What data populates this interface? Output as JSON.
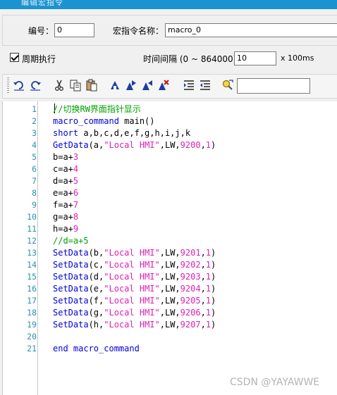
{
  "window": {
    "title": "编辑宏指令"
  },
  "header": {
    "id_label": "编号：",
    "id_value": "0",
    "name_label": "宏指令名称：",
    "name_value": "macro_0",
    "periodic_label": "周期执行",
    "periodic_checked": true,
    "interval_label": "时间间隔 (0 ~ 864000)：",
    "interval_value": "10",
    "interval_unit": "x 100ms"
  },
  "toolbar": {
    "buttons": [
      "undo-icon",
      "redo-icon",
      "cut-icon",
      "copy-icon",
      "paste-icon",
      "toggle-bookmark-icon",
      "next-bookmark-icon",
      "prev-bookmark-icon",
      "clear-bookmarks-icon",
      "indent-icon",
      "outdent-icon",
      "find-icon"
    ],
    "search_value": ""
  },
  "editor": {
    "lines": [
      {
        "n": "1",
        "t": [
          [
            "cmt",
            "//切换RW界面指针显示"
          ]
        ]
      },
      {
        "n": "2",
        "t": [
          [
            "kw",
            "macro_command"
          ],
          [
            "plain",
            " main()"
          ]
        ]
      },
      {
        "n": "3",
        "t": [
          [
            "kw",
            "short"
          ],
          [
            "plain",
            " a,b,c,d,e,f,g,h,i,j,k"
          ]
        ]
      },
      {
        "n": "4",
        "t": [
          [
            "fn",
            "GetData"
          ],
          [
            "plain",
            "(a,"
          ],
          [
            "str",
            "\"Local HMI\""
          ],
          [
            "plain",
            ",LW,"
          ],
          [
            "num",
            "9200"
          ],
          [
            "plain",
            ","
          ],
          [
            "num",
            "1"
          ],
          [
            "plain",
            ")"
          ]
        ]
      },
      {
        "n": "5",
        "t": [
          [
            "plain",
            "b=a+"
          ],
          [
            "num",
            "3"
          ]
        ]
      },
      {
        "n": "6",
        "t": [
          [
            "plain",
            "c=a+"
          ],
          [
            "num",
            "4"
          ]
        ]
      },
      {
        "n": "7",
        "t": [
          [
            "plain",
            "d=a+"
          ],
          [
            "num",
            "5"
          ]
        ]
      },
      {
        "n": "8",
        "t": [
          [
            "plain",
            "e=a+"
          ],
          [
            "num",
            "6"
          ]
        ]
      },
      {
        "n": "9",
        "t": [
          [
            "plain",
            "f=a+"
          ],
          [
            "num",
            "7"
          ]
        ]
      },
      {
        "n": "10",
        "t": [
          [
            "plain",
            "g=a+"
          ],
          [
            "num",
            "8"
          ]
        ]
      },
      {
        "n": "11",
        "t": [
          [
            "plain",
            "h=a+"
          ],
          [
            "num",
            "9"
          ]
        ]
      },
      {
        "n": "12",
        "t": [
          [
            "cmt",
            "//d=a+5"
          ]
        ]
      },
      {
        "n": "13",
        "t": [
          [
            "fn",
            "SetData"
          ],
          [
            "plain",
            "(b,"
          ],
          [
            "str",
            "\"Local HMI\""
          ],
          [
            "plain",
            ",LW,"
          ],
          [
            "num",
            "9201"
          ],
          [
            "plain",
            ","
          ],
          [
            "num",
            "1"
          ],
          [
            "plain",
            ")"
          ]
        ]
      },
      {
        "n": "14",
        "t": [
          [
            "fn",
            "SetData"
          ],
          [
            "plain",
            "(c,"
          ],
          [
            "str",
            "\"Local HMI\""
          ],
          [
            "plain",
            ",LW,"
          ],
          [
            "num",
            "9202"
          ],
          [
            "plain",
            ","
          ],
          [
            "num",
            "1"
          ],
          [
            "plain",
            ")"
          ]
        ]
      },
      {
        "n": "15",
        "t": [
          [
            "fn",
            "SetData"
          ],
          [
            "plain",
            "(d,"
          ],
          [
            "str",
            "\"Local HMI\""
          ],
          [
            "plain",
            ",LW,"
          ],
          [
            "num",
            "9203"
          ],
          [
            "plain",
            ","
          ],
          [
            "num",
            "1"
          ],
          [
            "plain",
            ")"
          ]
        ]
      },
      {
        "n": "16",
        "t": [
          [
            "fn",
            "SetData"
          ],
          [
            "plain",
            "(e,"
          ],
          [
            "str",
            "\"Local HMI\""
          ],
          [
            "plain",
            ",LW,"
          ],
          [
            "num",
            "9204"
          ],
          [
            "plain",
            ","
          ],
          [
            "num",
            "1"
          ],
          [
            "plain",
            ")"
          ]
        ]
      },
      {
        "n": "17",
        "t": [
          [
            "fn",
            "SetData"
          ],
          [
            "plain",
            "(f,"
          ],
          [
            "str",
            "\"Local HMI\""
          ],
          [
            "plain",
            ",LW,"
          ],
          [
            "num",
            "9205"
          ],
          [
            "plain",
            ","
          ],
          [
            "num",
            "1"
          ],
          [
            "plain",
            ")"
          ]
        ]
      },
      {
        "n": "18",
        "t": [
          [
            "fn",
            "SetData"
          ],
          [
            "plain",
            "(g,"
          ],
          [
            "str",
            "\"Local HMI\""
          ],
          [
            "plain",
            ",LW,"
          ],
          [
            "num",
            "9206"
          ],
          [
            "plain",
            ","
          ],
          [
            "num",
            "1"
          ],
          [
            "plain",
            ")"
          ]
        ]
      },
      {
        "n": "19",
        "t": [
          [
            "fn",
            "SetData"
          ],
          [
            "plain",
            "(h,"
          ],
          [
            "str",
            "\"Local HMI\""
          ],
          [
            "plain",
            ",LW,"
          ],
          [
            "num",
            "9207"
          ],
          [
            "plain",
            ","
          ],
          [
            "num",
            "1"
          ],
          [
            "plain",
            ")"
          ]
        ]
      },
      {
        "n": "20",
        "t": []
      },
      {
        "n": "21",
        "t": [
          [
            "kw",
            "end macro_command"
          ]
        ]
      }
    ]
  },
  "colors": {
    "titlebar": "#1a93d0",
    "function": "#0000d8",
    "keyword": "#0000d8",
    "string": "#e01eb5",
    "number": "#e01eb5",
    "comment": "#00a000",
    "line_number": "#2b91af"
  },
  "watermark": "CSDN @YAYAWWE"
}
